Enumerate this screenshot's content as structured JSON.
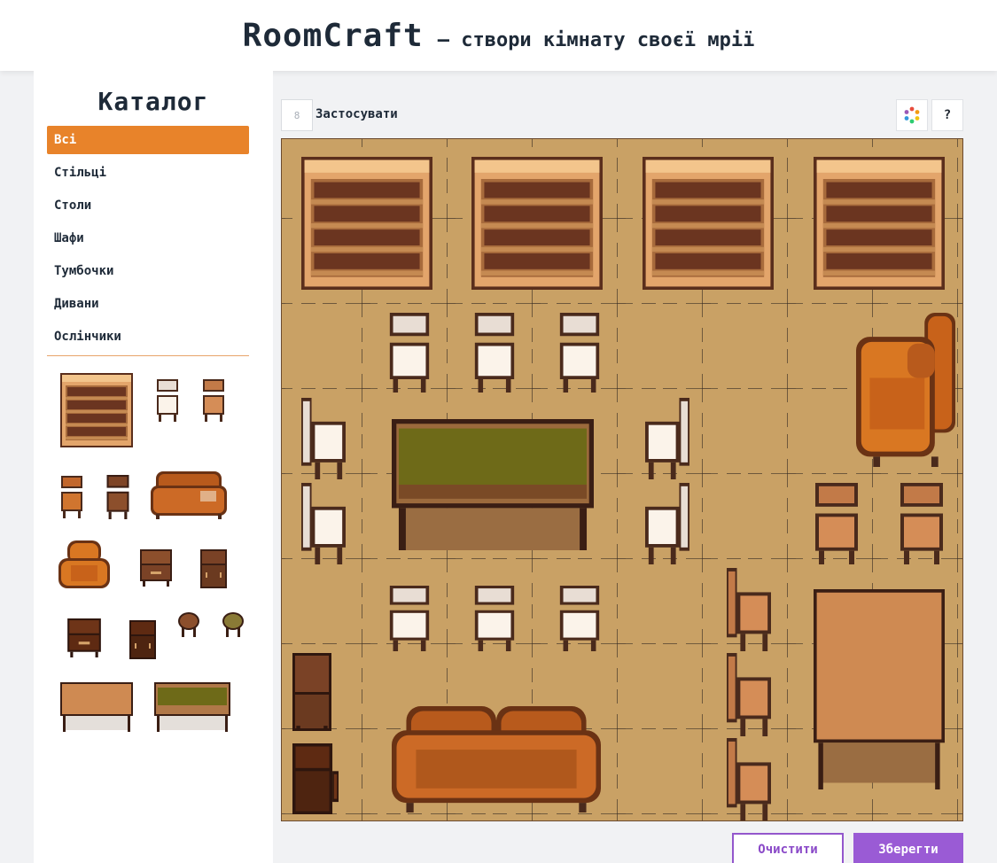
{
  "header": {
    "brand": "RoomCraft",
    "tagline": "— створи кімнату своєї мрії"
  },
  "catalog": {
    "title": "Каталог",
    "categories": [
      {
        "label": "Всі",
        "active": true
      },
      {
        "label": "Стільці",
        "active": false
      },
      {
        "label": "Столи",
        "active": false
      },
      {
        "label": "Шафи",
        "active": false
      },
      {
        "label": "Тумбочки",
        "active": false
      },
      {
        "label": "Дивани",
        "active": false
      },
      {
        "label": "Ослінчики",
        "active": false
      }
    ],
    "items": [
      "bookcase",
      "chair-white",
      "chair-wood",
      "chair-wood",
      "chair-dark",
      "sofa",
      "armchair",
      "nightstand",
      "cabinet",
      "nightstand-dark",
      "cabinet-dark",
      "stool-dark",
      "stool-olive",
      "table-wood",
      "table-olive"
    ]
  },
  "toolbar": {
    "toggle_icon": "8",
    "apply_label": "Застосувати",
    "help_label": "?",
    "palette_icon": "color-wheel-icon"
  },
  "actions": {
    "clear_label": "Очистити",
    "save_label": "Зберегти"
  },
  "colors": {
    "accent_orange": "#e8832a",
    "accent_purple": "#9a5bd5",
    "floor": "#c9a165"
  }
}
